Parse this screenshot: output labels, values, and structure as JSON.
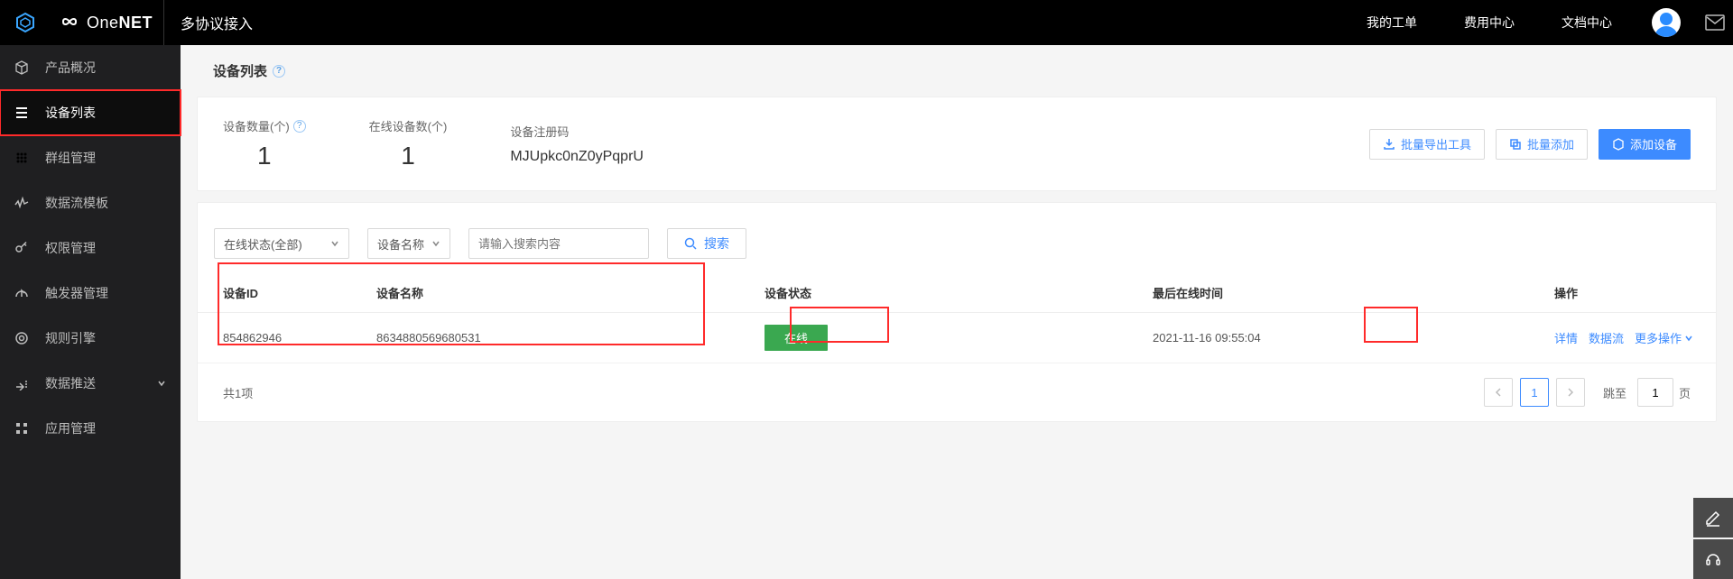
{
  "header": {
    "brand": "OneNET",
    "title": "多协议接入",
    "nav": [
      "我的工单",
      "费用中心",
      "文档中心"
    ]
  },
  "sidebar": {
    "items": [
      {
        "label": "产品概况"
      },
      {
        "label": "设备列表"
      },
      {
        "label": "群组管理"
      },
      {
        "label": "数据流模板"
      },
      {
        "label": "权限管理"
      },
      {
        "label": "触发器管理"
      },
      {
        "label": "规则引擎"
      },
      {
        "label": "数据推送"
      },
      {
        "label": "应用管理"
      }
    ],
    "active_index": 1
  },
  "page": {
    "title": "设备列表",
    "help": "?"
  },
  "stats": {
    "device_count_label": "设备数量(个)",
    "device_count_value": "1",
    "online_count_label": "在线设备数(个)",
    "online_count_value": "1",
    "reg_code_label": "设备注册码",
    "reg_code_value": "MJUpkc0nZ0yPqprU"
  },
  "actions": {
    "export_label": "批量导出工具",
    "batch_add_label": "批量添加",
    "add_label": "添加设备"
  },
  "filters": {
    "status_select": "在线状态(全部)",
    "name_select": "设备名称",
    "search_placeholder": "请输入搜索内容",
    "search_button": "搜索"
  },
  "table": {
    "columns": {
      "id": "设备ID",
      "name": "设备名称",
      "status": "设备状态",
      "last_online": "最后在线时间",
      "ops": "操作"
    },
    "rows": [
      {
        "id": "854862946",
        "name": "8634880569680531",
        "status": "在线",
        "last_online": "2021-11-16 09:55:04"
      }
    ],
    "ops": {
      "detail": "详情",
      "datastream": "数据流",
      "more": "更多操作"
    }
  },
  "pager": {
    "total_label": "共1项",
    "current": "1",
    "jump_prefix": "跳至",
    "jump_value": "1",
    "jump_suffix": "页"
  }
}
